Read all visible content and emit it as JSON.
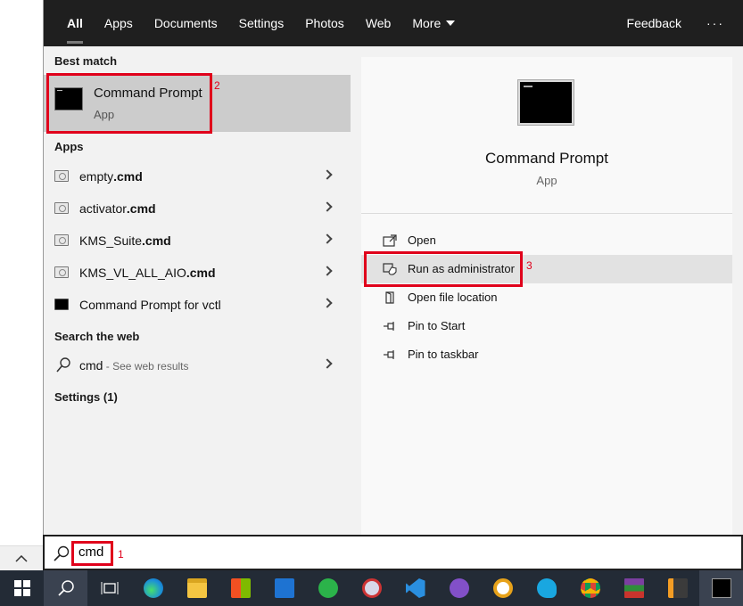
{
  "tabs": [
    {
      "label": "All",
      "active": true
    },
    {
      "label": "Apps"
    },
    {
      "label": "Documents"
    },
    {
      "label": "Settings"
    },
    {
      "label": "Photos"
    },
    {
      "label": "Web"
    },
    {
      "label": "More"
    }
  ],
  "feedback_label": "Feedback",
  "more_options_label": "···",
  "best_match": {
    "heading": "Best match",
    "title": "Command Prompt",
    "type": "App"
  },
  "apps": {
    "heading": "Apps",
    "items": [
      {
        "name": "empty",
        "ext": ".cmd"
      },
      {
        "name": "activator",
        "ext": ".cmd"
      },
      {
        "name": "KMS_Suite",
        "ext": ".cmd"
      },
      {
        "name": "KMS_VL_ALL_AIO",
        "ext": ".cmd"
      },
      {
        "name": "Command Prompt for vctl",
        "ext": ""
      }
    ]
  },
  "web": {
    "heading": "Search the web",
    "query": "cmd",
    "hint": " - See web results"
  },
  "settings_heading": "Settings (1)",
  "detail": {
    "title": "Command Prompt",
    "type": "App",
    "actions": [
      {
        "label": "Open",
        "icon": "open-icon"
      },
      {
        "label": "Run as administrator",
        "icon": "shield-icon"
      },
      {
        "label": "Open file location",
        "icon": "folder-icon"
      },
      {
        "label": "Pin to Start",
        "icon": "pin-icon"
      },
      {
        "label": "Pin to taskbar",
        "icon": "pin-icon"
      }
    ]
  },
  "search": {
    "value": "cmd"
  },
  "annotations": {
    "one": "1",
    "two": "2",
    "three": "3"
  },
  "taskbar": [
    "windows-start-icon",
    "search-icon",
    "task-view-icon",
    "edge-icon",
    "file-explorer-icon",
    "store-icon",
    "mail-icon",
    "terminal-app-icon",
    "paint-icon",
    "vscode-icon",
    "github-icon",
    "browser-shield-icon",
    "edge-beta-icon",
    "chrome-icon",
    "winrar-icon",
    "sublime-text-icon",
    "cmd-icon"
  ]
}
